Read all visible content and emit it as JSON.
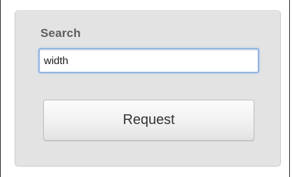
{
  "search": {
    "label": "Search",
    "value": "width"
  },
  "actions": {
    "request_label": "Request"
  }
}
